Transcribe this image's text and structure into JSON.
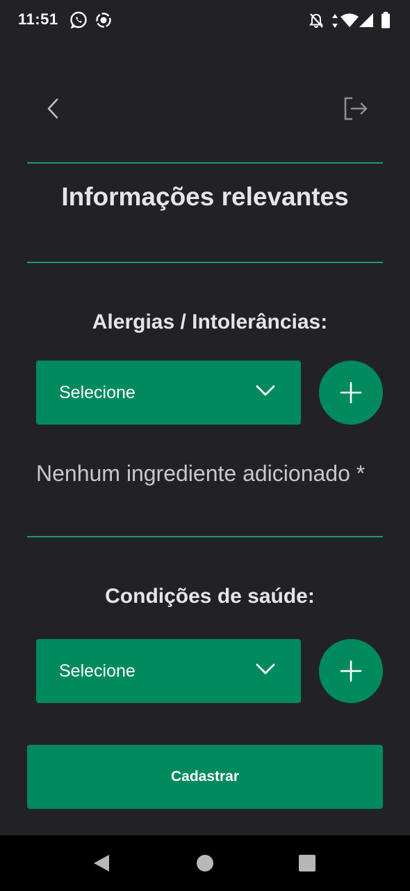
{
  "status_bar": {
    "time": "11:51",
    "left_icons": [
      "whatsapp-icon",
      "screen-record-icon"
    ],
    "right_icons": [
      "notifications-off-icon",
      "data-arrows-icon",
      "wifi-icon",
      "cell-signal-icon",
      "battery-icon"
    ]
  },
  "header": {
    "back_icon": "chevron-left-icon",
    "logout_icon": "logout-icon"
  },
  "page": {
    "title": "Informações relevantes"
  },
  "allergies": {
    "title": "Alergias / Intolerâncias:",
    "select_value": "Selecione",
    "empty_text": "Nenhum ingrediente adicionado *"
  },
  "health": {
    "title": "Condições de saúde:",
    "select_value": "Selecione"
  },
  "actions": {
    "submit_label": "Cadastrar"
  },
  "nav": {
    "icons": [
      "nav-back-icon",
      "nav-home-icon",
      "nav-recents-icon"
    ]
  },
  "colors": {
    "background": "#222226",
    "accent": "#008a5e",
    "divider": "#1f9a6d",
    "text": "#e6e6ea"
  }
}
